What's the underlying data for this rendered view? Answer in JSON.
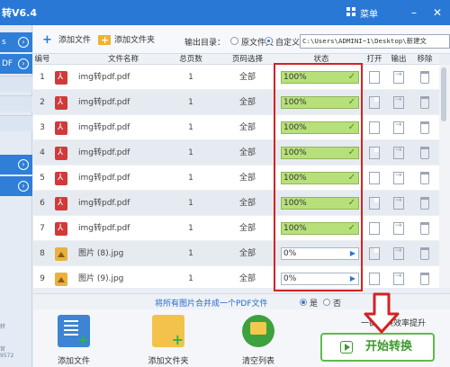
{
  "app": {
    "title_partial": "转V6.4",
    "menu_label": "菜单"
  },
  "window_controls": {
    "minimize": "–",
    "close": "✕"
  },
  "sidebar": {
    "items": [
      {
        "label": "s"
      },
      {
        "label": "DF"
      }
    ],
    "footer_text": [
      "转",
      "官",
      "9572"
    ]
  },
  "toolbar": {
    "add_file": "添加文件",
    "add_folder": "添加文件夹",
    "output_dir_label": "输出目录：",
    "option_original": "原文件夹",
    "option_custom": "自定义",
    "selected_option": "custom",
    "path_value": "C:\\Users\\ADMINI~1\\Desktop\\新建文"
  },
  "table": {
    "headers": {
      "index": "编号",
      "filename": "文件名称",
      "pages": "总页数",
      "page_select": "页码选择",
      "status": "状态",
      "open": "打开",
      "output": "输出",
      "remove": "移除"
    },
    "rows": [
      {
        "index": "1",
        "filename": "img转pdf.pdf",
        "type": "pdf",
        "pages": "1",
        "page_select": "全部",
        "status": "100%",
        "done": true
      },
      {
        "index": "2",
        "filename": "img转pdf.pdf",
        "type": "pdf",
        "pages": "1",
        "page_select": "全部",
        "status": "100%",
        "done": true
      },
      {
        "index": "3",
        "filename": "img转pdf.pdf",
        "type": "pdf",
        "pages": "1",
        "page_select": "全部",
        "status": "100%",
        "done": true
      },
      {
        "index": "4",
        "filename": "img转pdf.pdf",
        "type": "pdf",
        "pages": "1",
        "page_select": "全部",
        "status": "100%",
        "done": true
      },
      {
        "index": "5",
        "filename": "img转pdf.pdf",
        "type": "pdf",
        "pages": "1",
        "page_select": "全部",
        "status": "100%",
        "done": true
      },
      {
        "index": "6",
        "filename": "img转pdf.pdf",
        "type": "pdf",
        "pages": "1",
        "page_select": "全部",
        "status": "100%",
        "done": true
      },
      {
        "index": "7",
        "filename": "img转pdf.pdf",
        "type": "pdf",
        "pages": "1",
        "page_select": "全部",
        "status": "100%",
        "done": true
      },
      {
        "index": "8",
        "filename": "图片 (8).jpg",
        "type": "jpg",
        "pages": "1",
        "page_select": "全部",
        "status": "0%",
        "done": false
      },
      {
        "index": "9",
        "filename": "图片 (9).jpg",
        "type": "jpg",
        "pages": "1",
        "page_select": "全部",
        "status": "0%",
        "done": false
      }
    ]
  },
  "merge": {
    "text": "将所有图片合并成一个PDF文件",
    "yes": "是",
    "no": "否",
    "selected": "yes"
  },
  "bottom": {
    "add_file": "添加文件",
    "add_folder": "添加文件夹",
    "clear_list": "清空列表",
    "efficiency_pre": "一键转换",
    "efficiency": "效率提升",
    "start": "开始转换"
  },
  "colors": {
    "title_bar": "#2a78d6",
    "status_done": "#b8e07a",
    "highlight": "#d42222",
    "start_button": "#5fbb4d"
  },
  "icons": [
    "menu-grid-icon",
    "plus-icon",
    "folder-icon",
    "pdf-file-icon",
    "image-file-icon",
    "open-icon",
    "export-icon",
    "trash-icon",
    "check-icon",
    "play-icon",
    "arrow-down-icon"
  ]
}
